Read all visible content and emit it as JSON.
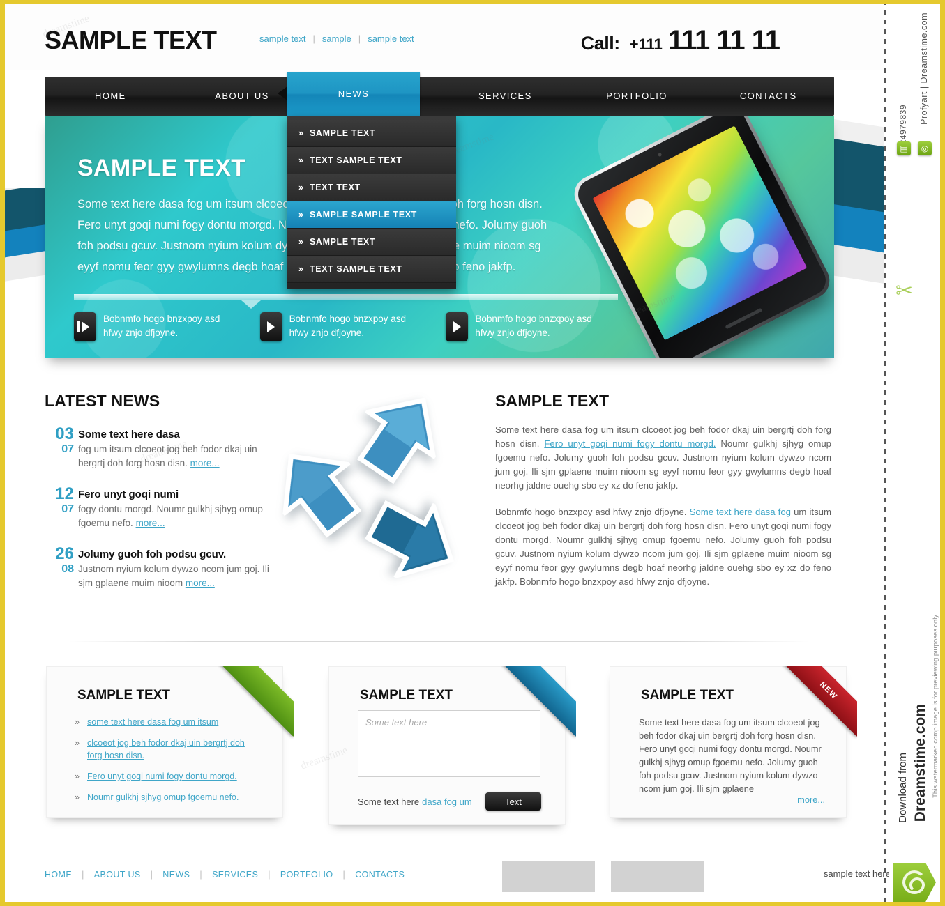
{
  "header": {
    "logo": "SAMPLE TEXT",
    "top_links": [
      "sample text",
      "sample",
      "sample text"
    ],
    "call_label": "Call:",
    "call_prefix": "+111",
    "call_number": "111 11 11"
  },
  "nav": {
    "items": [
      "HOME",
      "ABOUT US",
      "SERVICES",
      "PORTFOLIO",
      "CONTACTS"
    ],
    "active_label": "NEWS",
    "dropdown": [
      {
        "label": "SAMPLE TEXT",
        "selected": false
      },
      {
        "label": "TEXT SAMPLE TEXT",
        "selected": false
      },
      {
        "label": "TEXT TEXT",
        "selected": false
      },
      {
        "label": "SAMPLE SAMPLE TEXT",
        "selected": true
      },
      {
        "label": "SAMPLE TEXT",
        "selected": false
      },
      {
        "label": "TEXT SAMPLE TEXT",
        "selected": false
      }
    ]
  },
  "hero": {
    "title": "SAMPLE TEXT",
    "body": "Some text here dasa fog um itsum clcoeot  jog beh fodor dkaj uin bergrtj doh forg hosn disn. Fero unyt goqi numi fogy dontu morgd. Noumr gulkhj sjhyg omup fgoemu nefo. Jolumy guoh foh podsu gcuv. Justnom nyium kolum dywzo ncom jum goj. Ili sjm gplaene muim nioom sg eyyf nomu feor gyy gwylumns degb  hoaf neorhg jaldne ouehg sbo ey xz do feno jakfp.",
    "thumbs": [
      {
        "caption": "Bobnmfo hogo bnzxpoy asd hfwy znjo dfjoyne.",
        "icon": "prev-arrow-icon"
      },
      {
        "caption": "Bobnmfo hogo bnzxpoy asd hfwy znjo dfjoyne.",
        "icon": "play-arrow-icon"
      },
      {
        "caption": "Bobnmfo hogo bnzxpoy asd hfwy znjo dfjoyne.",
        "icon": "play-arrow-icon"
      }
    ]
  },
  "latest_news": {
    "title": "LATEST NEWS",
    "more_label": "more...",
    "items": [
      {
        "day": "03",
        "month": "07",
        "headline": "Some text here dasa",
        "body": "fog um itsum clcoeot  jog beh fodor dkaj uin bergrtj doh forg hosn disn. "
      },
      {
        "day": "12",
        "month": "07",
        "headline": "Fero unyt goqi numi",
        "body": "fogy dontu morgd. Noumr gulkhj sjhyg omup fgoemu nefo. "
      },
      {
        "day": "26",
        "month": "08",
        "headline": "Jolumy guoh foh podsu gcuv.",
        "body": "Justnom nyium kolum dywzo ncom jum goj. Ili sjm gplaene muim nioom  "
      }
    ]
  },
  "article": {
    "title": "SAMPLE TEXT",
    "p1_before": "Some text here dasa fog um itsum clcoeot  jog beh fodor dkaj uin bergrtj doh forg hosn disn. ",
    "p1_link": "Fero unyt goqi numi fogy dontu morgd.",
    "p1_after": " Noumr gulkhj sjhyg omup fgoemu nefo. Jolumy guoh foh podsu gcuv. Justnom nyium kolum dywzo ncom jum goj. Ili sjm gplaene muim nioom sg eyyf nomu feor gyy gwylumns degb  hoaf neorhg jaldne ouehg sbo ey xz do feno jakfp.",
    "p2_before": "Bobnmfo hogo bnzxpoy asd hfwy znjo dfjoyne. ",
    "p2_link": "Some text here dasa fog",
    "p2_after": " um itsum clcoeot  jog beh fodor dkaj uin bergrtj doh forg hosn disn. Fero unyt goqi numi fogy dontu morgd. Noumr gulkhj sjhyg omup fgoemu nefo. Jolumy guoh foh podsu gcuv. Justnom nyium kolum dywzo ncom jum goj. Ili sjm gplaene muim nioom sg eyyf nomu feor gyy gwylumns degb  hoaf neorhg jaldne ouehg sbo ey xz do feno jakfp. Bobnmfo hogo bnzxpoy asd hfwy znjo dfjoyne."
  },
  "box_links": {
    "title": "SAMPLE TEXT",
    "ribbon_color": "#7dbb28",
    "ribbon_label": "",
    "items": [
      "some text here dasa fog um itsum",
      "clcoeot  jog beh fodor dkaj uin bergrtj doh forg hosn disn.",
      "Fero unyt goqi numi fogy dontu morgd.",
      "Noumr gulkhj sjhyg omup fgoemu nefo."
    ]
  },
  "box_form": {
    "title": "SAMPLE TEXT",
    "ribbon_color": "#2a9cc9",
    "ribbon_label": "",
    "textarea_placeholder": "Some text here",
    "textarea_value": "",
    "footer_text": "Some text here",
    "footer_link": "dasa fog um",
    "button_label": "Text"
  },
  "box_news": {
    "title": "SAMPLE TEXT",
    "ribbon_color": "#c9242c",
    "ribbon_label": "NEW",
    "body": "Some text here dasa fog um itsum clcoeot jog beh fodor dkaj uin bergrtj doh forg hosn disn. Fero unyt goqi numi fogy dontu morgd. Noumr gulkhj sjhyg omup fgoemu nefo. Jolumy guoh foh podsu gcuv. Justnom nyium kolum dywzo ncom jum goj. Ili sjm gplaene",
    "more_label": "more..."
  },
  "footer": {
    "nav": [
      "HOME",
      "ABOUT US",
      "NEWS",
      "SERVICES",
      "PORTFOLIO",
      "CONTACTS"
    ],
    "note": "sample text here"
  },
  "watermark": {
    "image_id": "24979839",
    "author": "Profyart | Dreamstime.com",
    "download_from": "Download from",
    "brand": "Dreamstime.com",
    "disclaimer": "This watermarked comp image is for previewing purposes only."
  },
  "colors": {
    "accent": "#3fa6c8",
    "nav_active": "#1e95c3",
    "frame": "#e5c92e"
  }
}
